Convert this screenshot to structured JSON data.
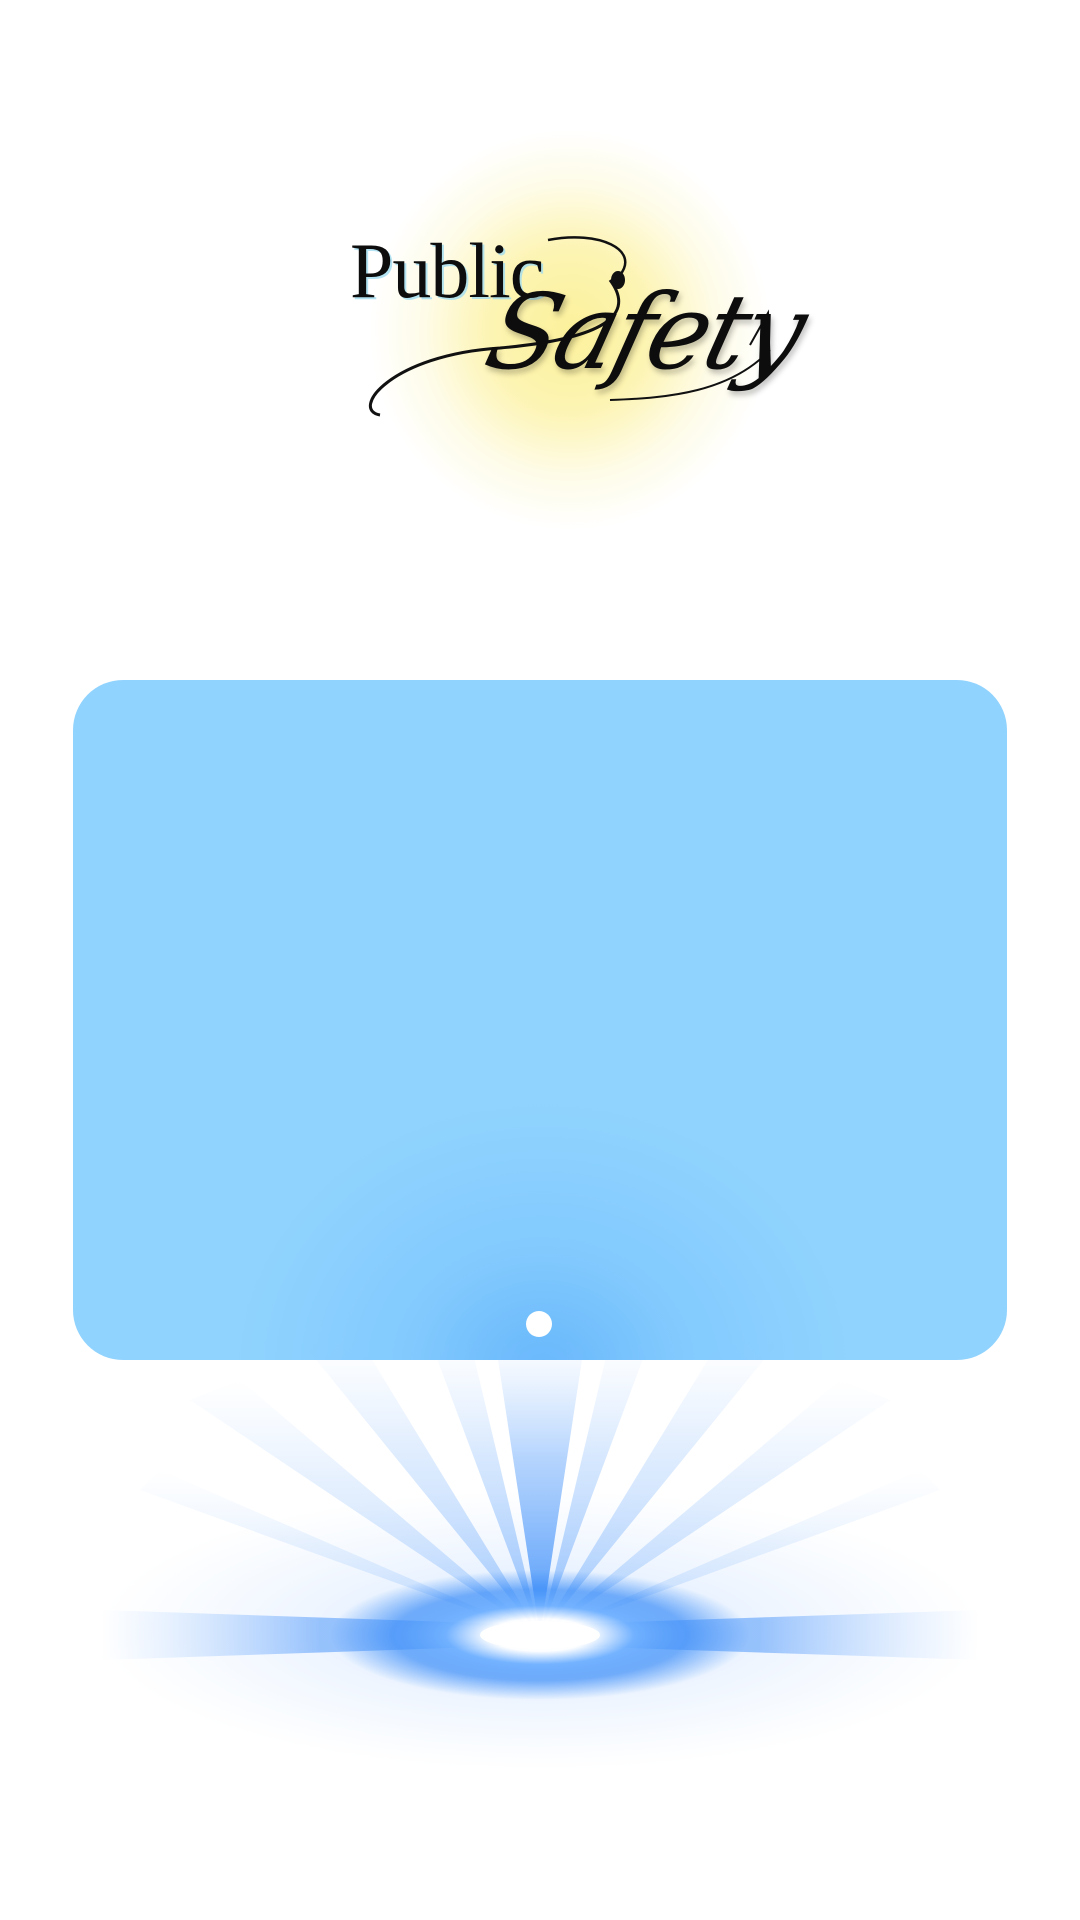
{
  "logo": {
    "word_public": "Public",
    "word_safety": "Safety",
    "glow_color": "#fcf096",
    "text_color": "#0d0d0d"
  },
  "panel": {
    "background_color": "#90d3fe",
    "indicator_color": "#ffffff"
  },
  "light_effect": {
    "color": "#3d8ef8",
    "core_color": "#ffffff"
  }
}
